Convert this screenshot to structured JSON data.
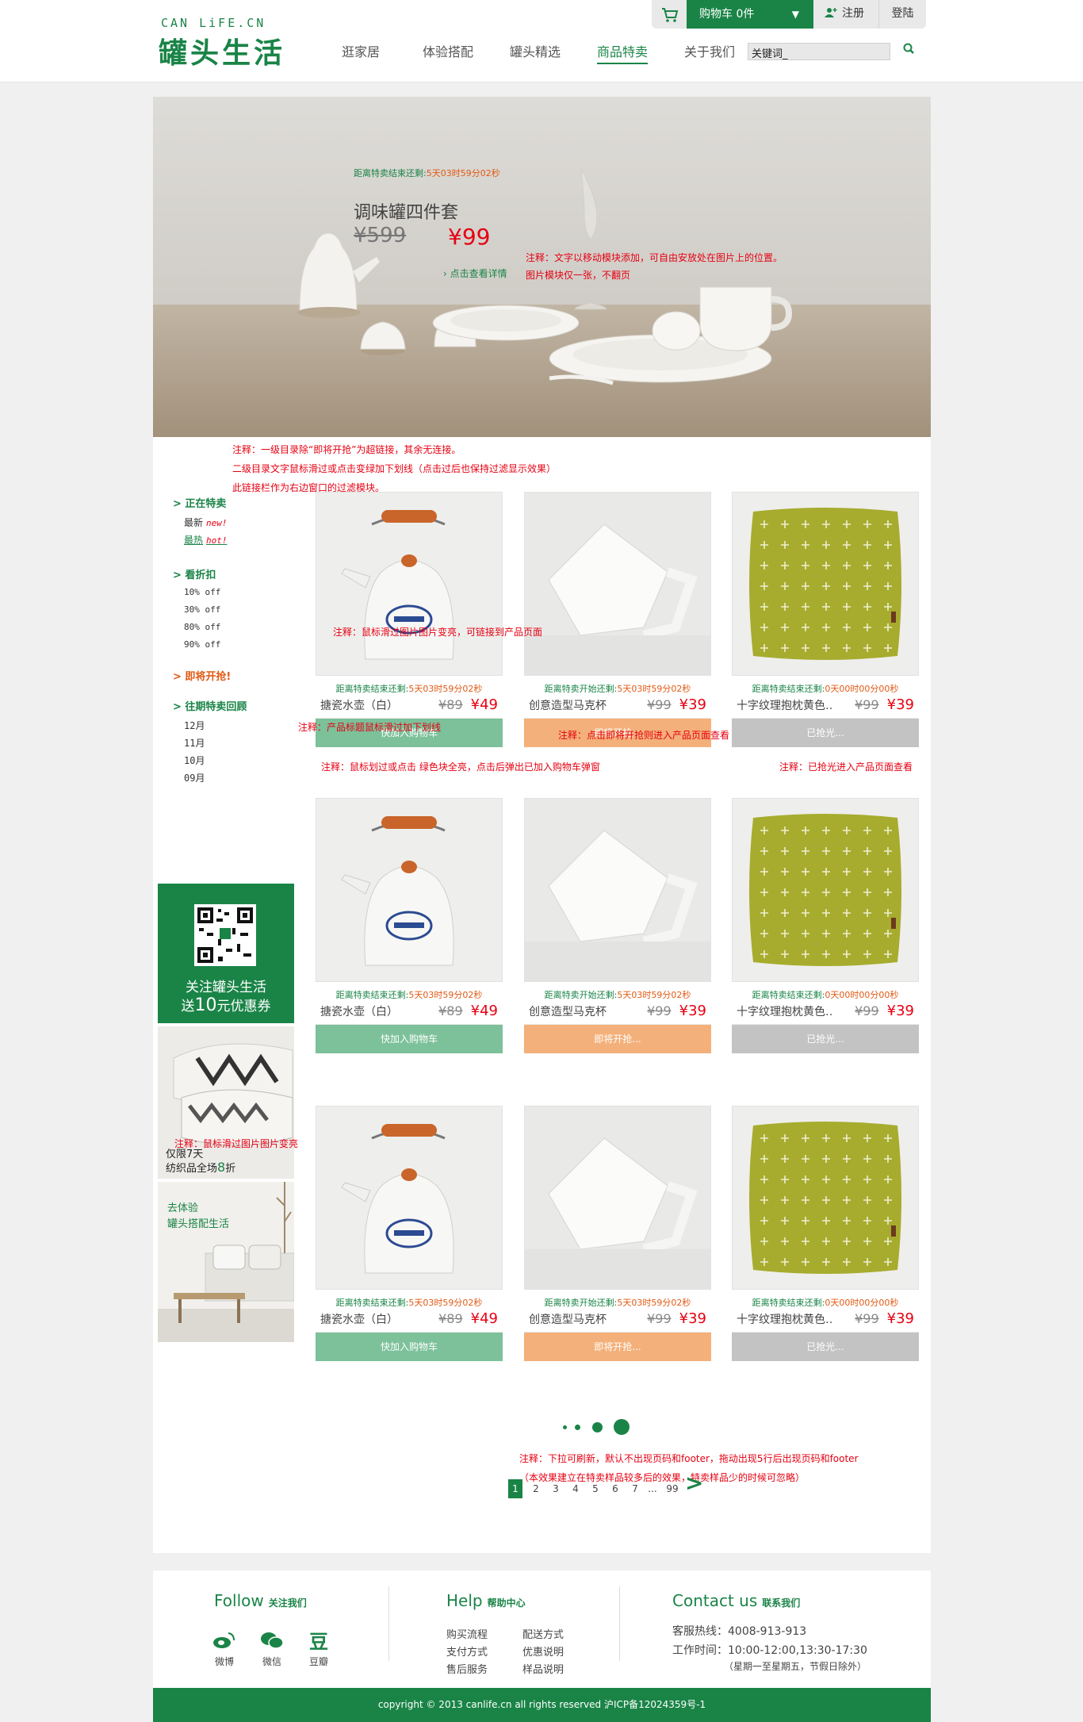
{
  "brand": {
    "sub": "CAN   LiFE.CN",
    "main": "罐头生活"
  },
  "nav": [
    "逛家居",
    "体验搭配",
    "罐头精选",
    "商品特卖",
    "关于我们"
  ],
  "search": {
    "value": "关键词_"
  },
  "topbar": {
    "cart": "购物车 0件",
    "register": "注册",
    "login": "登陆"
  },
  "banner": {
    "countdown_label": "距离特卖结束还剩:",
    "countdown_value": "5天03时59分02秒",
    "title": "调味罐四件套",
    "old_price": "¥599",
    "new_price": "¥99",
    "detail_link": "点击查看详情",
    "note1": "注释：文字以移动模块添加，可自由安放处在图片上的位置。",
    "note2": "图片模块仅一张，不翻页"
  },
  "notes": {
    "top1": "注释：一级目录除“即将开抢”为超链接，其余无连接。",
    "top2": "二级目录文字鼠标滑过或点击变绿加下划线（点击过后也保持过滤显示效果）",
    "top3": "此链接栏作为右边窗口的过滤模块。",
    "img_hover": "注释：鼠标滑过图片图片变亮，可链接到产品页面",
    "title_hover": "注释：产品标题鼠标滑过加下划线",
    "coming": "注释：点击即将开抢则进入产品页面查看",
    "cart_btn": "注释：鼠标划过或点击 绿色块全亮，点击后弹出已加入购物车弹窗",
    "sold_out": "注释：已抢光进入产品页面查看",
    "side_img": "注释：鼠标滑过图片图片变亮",
    "pager1": "注释：下拉可刷新，默认不出现页码和footer，拖动出现5行后出现页码和footer",
    "pager2": "（本效果建立在特卖样品较多后的效果，特卖样品少的时候可忽略）"
  },
  "sidebar": {
    "groups": [
      {
        "title": "正在特卖",
        "items": [
          {
            "label": "最新",
            "tag": "new!"
          },
          {
            "label": "最热",
            "tag": "hot!"
          }
        ]
      },
      {
        "title": "看折扣",
        "items": [
          {
            "label": "10% off"
          },
          {
            "label": "30% off"
          },
          {
            "label": "80% off"
          },
          {
            "label": "90% off"
          }
        ]
      },
      {
        "title": "即将开抢!",
        "items": []
      },
      {
        "title": "往期特卖回顾",
        "items": [
          {
            "label": "12月"
          },
          {
            "label": "11月"
          },
          {
            "label": "10月"
          },
          {
            "label": "09月"
          }
        ]
      }
    ],
    "promo_qr_line1": "关注罐头生活",
    "promo_qr_line2_pre": "送",
    "promo_qr_line2_num": "10",
    "promo_qr_line2_post": "元优惠券",
    "promo2_line1": "仅限7天",
    "promo2_line2_pre": "纺织品全场",
    "promo2_line2_num": "8",
    "promo2_line2_post": "折",
    "promo3_line1": "去体验",
    "promo3_line2": "罐头搭配生活"
  },
  "products": {
    "rows": [
      [
        {
          "count_label": "距离特卖结束还剩:",
          "count_value": "5天03时59分02秒",
          "name": "搪瓷水壶（白）",
          "old": "¥89",
          "new": "¥49",
          "btn": "快加入购物车"
        },
        {
          "count_label": "距离特卖开始还剩:",
          "count_value": "5天03时59分02秒",
          "name": "创意造型马克杯",
          "old": "¥99",
          "new": "¥39",
          "btn": "即将开抢..."
        },
        {
          "count_label": "距离特卖结束还剩:",
          "count_value": "0天00时00分00秒",
          "name": "十字纹理抱枕黄色…",
          "old": "¥99",
          "new": "¥39",
          "btn": "已抢光..."
        }
      ],
      [
        {
          "count_label": "距离特卖结束还剩:",
          "count_value": "5天03时59分02秒",
          "name": "搪瓷水壶（白）",
          "old": "¥89",
          "new": "¥49",
          "btn": "快加入购物车"
        },
        {
          "count_label": "距离特卖开始还剩:",
          "count_value": "5天03时59分02秒",
          "name": "创意造型马克杯",
          "old": "¥99",
          "new": "¥39",
          "btn": "即将开抢..."
        },
        {
          "count_label": "距离特卖结束还剩:",
          "count_value": "0天00时00分00秒",
          "name": "十字纹理抱枕黄色…",
          "old": "¥99",
          "new": "¥39",
          "btn": "已抢光..."
        }
      ],
      [
        {
          "count_label": "距离特卖结束还剩:",
          "count_value": "5天03时59分02秒",
          "name": "搪瓷水壶（白）",
          "old": "¥89",
          "new": "¥49",
          "btn": "快加入购物车"
        },
        {
          "count_label": "距离特卖开始还剩:",
          "count_value": "5天03时59分02秒",
          "name": "创意造型马克杯",
          "old": "¥99",
          "new": "¥39",
          "btn": "即将开抢..."
        },
        {
          "count_label": "距离特卖结束还剩:",
          "count_value": "0天00时00分00秒",
          "name": "十字纹理抱枕黄色…",
          "old": "¥99",
          "new": "¥39",
          "btn": "已抢光..."
        }
      ]
    ]
  },
  "pager": {
    "pages": [
      "1",
      "2",
      "3",
      "4",
      "5",
      "6",
      "7",
      "...",
      "99"
    ],
    "next": ">"
  },
  "footer": {
    "follow_title": "Follow",
    "follow_sub": "关注我们",
    "social": [
      "微博",
      "微信",
      "豆瓣"
    ],
    "help_title": "Help",
    "help_sub": "帮助中心",
    "help_links": [
      "购买流程",
      "配送方式",
      "支付方式",
      "优惠说明",
      "售后服务",
      "样品说明"
    ],
    "contact_title": "Contact us",
    "contact_sub": "联系我们",
    "hotline": "客服热线：4008-913-913",
    "hours": "工作时间：10:00-12:00,13:30-17:30",
    "days": "（星期一至星期五，节假日除外）",
    "copyright": "copyright © 2013 canlife.cn all rights reserved    沪ICP备12024359号-1"
  },
  "colors": {
    "brand_green": "#1a8447",
    "btn_green": "#7cc19a",
    "btn_orange": "#f4b07a",
    "btn_gray": "#c3c3c3",
    "note_red": "#e60012"
  }
}
